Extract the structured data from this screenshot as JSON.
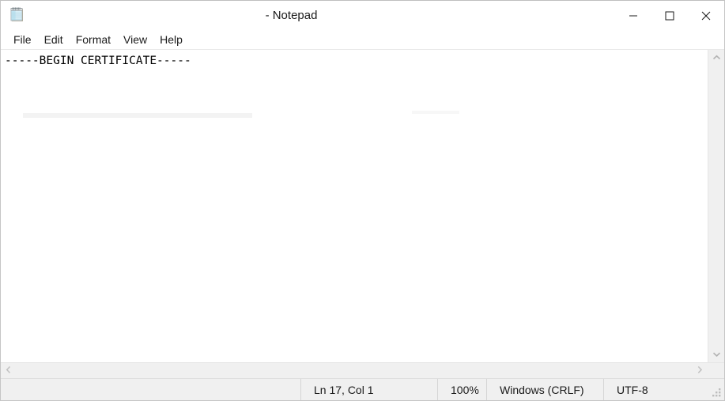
{
  "window": {
    "title": "- Notepad",
    "document_name": "",
    "app_name": "Notepad",
    "icon": "notepad-icon"
  },
  "titlebar": {
    "minimize_label": "Minimize",
    "maximize_label": "Maximize",
    "close_label": "Close",
    "minimize_icon": "minimize-icon",
    "maximize_icon": "maximize-icon",
    "close_icon": "close-icon"
  },
  "menubar": {
    "items": [
      {
        "label": "File"
      },
      {
        "label": "Edit"
      },
      {
        "label": "Format"
      },
      {
        "label": "View"
      },
      {
        "label": "Help"
      }
    ]
  },
  "editor": {
    "content": "-----BEGIN CERTIFICATE-----",
    "caret_visible": true
  },
  "scrollbars": {
    "vertical": {
      "up_icon": "chevron-up-icon",
      "down_icon": "chevron-down-icon"
    },
    "horizontal": {
      "left_icon": "chevron-left-icon",
      "right_icon": "chevron-right-icon"
    }
  },
  "statusbar": {
    "cursor_position": "Ln 17, Col 1",
    "zoom": "100%",
    "line_ending": "Windows (CRLF)",
    "encoding": "UTF-8",
    "grip_icon": "resize-grip-icon"
  },
  "colors": {
    "window_bg": "#ffffff",
    "chrome_bg": "#f0f0f0",
    "border": "#c5c5c5",
    "text": "#1a1a1a",
    "scroll_arrow": "#b4b4b4"
  }
}
